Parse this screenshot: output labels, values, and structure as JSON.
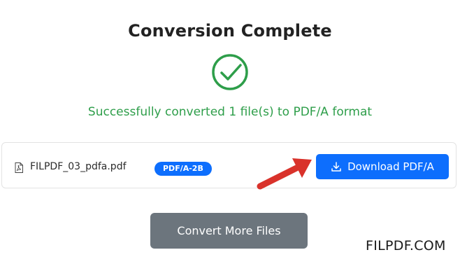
{
  "header": {
    "title": "Conversion Complete"
  },
  "status": {
    "icon": "check-circle-icon",
    "message": "Successfully converted 1 file(s) to PDF/A format",
    "color": "#2e9e4a"
  },
  "file": {
    "icon": "pdf-file-icon",
    "name": "FILPDF_03_pdfa.pdf",
    "badge": "PDF/A-2B",
    "download_label": "Download PDF/A",
    "download_icon": "download-icon"
  },
  "actions": {
    "convert_more_label": "Convert More Files"
  },
  "annotation": {
    "arrow_icon": "red-arrow-icon",
    "color": "#d9322b"
  },
  "watermark": {
    "text": "FILPDF.COM"
  },
  "colors": {
    "primary": "#0d6efd",
    "secondary": "#6c757d",
    "success": "#2e9e4a"
  }
}
